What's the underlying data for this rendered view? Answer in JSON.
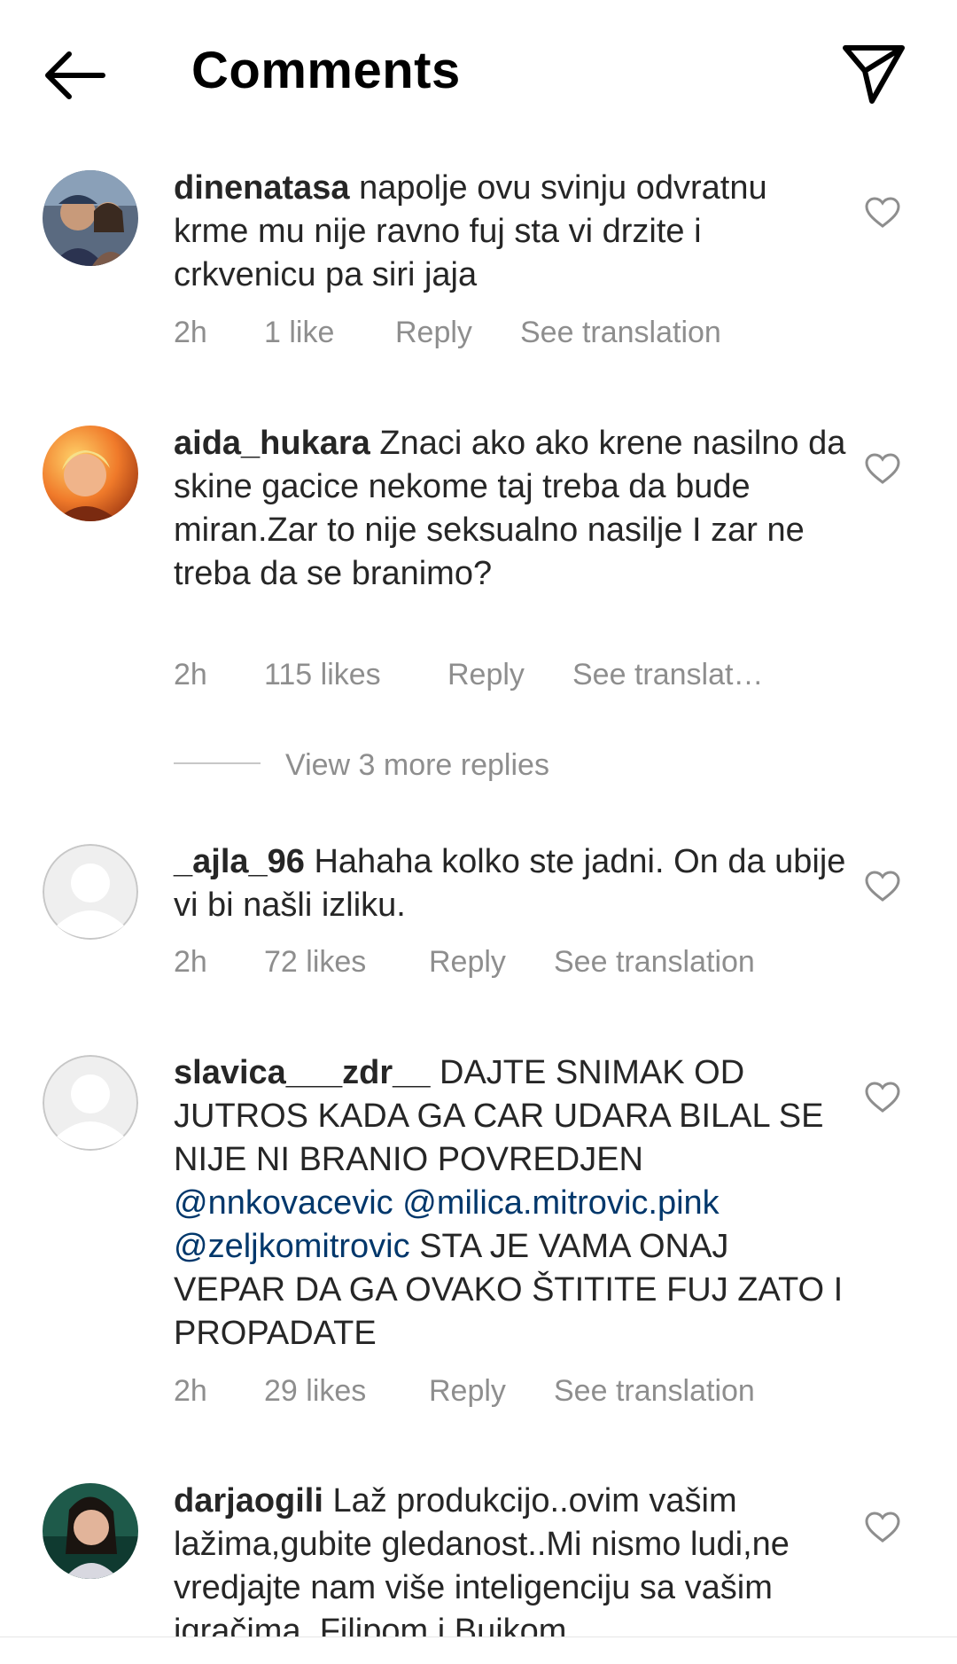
{
  "header": {
    "title": "Comments",
    "back_icon": "arrow-left-icon",
    "share_icon": "paper-plane-icon"
  },
  "comments": [
    {
      "username": "dinenatasa",
      "text": "napolje ovu svinju odvratnu krme mu nije ravno  fuj sta vi drzite  i crkvenicu pa siri jaja",
      "time": "2h",
      "likes": "1 like",
      "reply": "Reply",
      "translate": "See translation"
    },
    {
      "username": "aida_hukara",
      "text": "Znaci ako ako krene nasilno da skine gacice nekome taj treba da bude miran.Zar to nije seksualno nasilje I zar ne treba da se branimo?",
      "time": "2h",
      "likes": "115 likes",
      "reply": "Reply",
      "translate": "See translat…"
    },
    {
      "username": "_ajla_96",
      "text": "Hahaha kolko ste jadni. On da ubije vi bi našli izliku.",
      "time": "2h",
      "likes": "72 likes",
      "reply": "Reply",
      "translate": "See translation"
    },
    {
      "username": "slavica___zdr__",
      "text_before": "DAJTE SNIMAK OD JUTROS KADA GA CAR UDARA BILAL SE NIJE NI BRANIO POVREDJEN",
      "mention_1": "@nnkovacevic",
      "mention_2": "@milica.mitrovic.pink",
      "mention_3": "@zeljkomitrovic",
      "text_after": "STA JE VAMA ONAJ VEPAR DA GA OVAKO ŠTITITE FUJ ZATO I PROPADATE",
      "time": "2h",
      "likes": "29 likes",
      "reply": "Reply",
      "translate": "See translation"
    },
    {
      "username": "darjaogili",
      "text": "Laž produkcijo..ovim vašim lažima,gubite gledanost..Mi nismo ludi,ne vredjajte nam više inteligenciju sa vašim igračima, Filipom i Bujkom"
    }
  ],
  "view_replies": "View 3 more replies",
  "colors": {
    "text": "#262626",
    "secondary": "#8e8e8e",
    "mention": "#00376b",
    "divider": "#c7c7c7"
  },
  "icons": {
    "like": "heart-outline-icon",
    "default_avatar": "default-avatar-icon"
  }
}
